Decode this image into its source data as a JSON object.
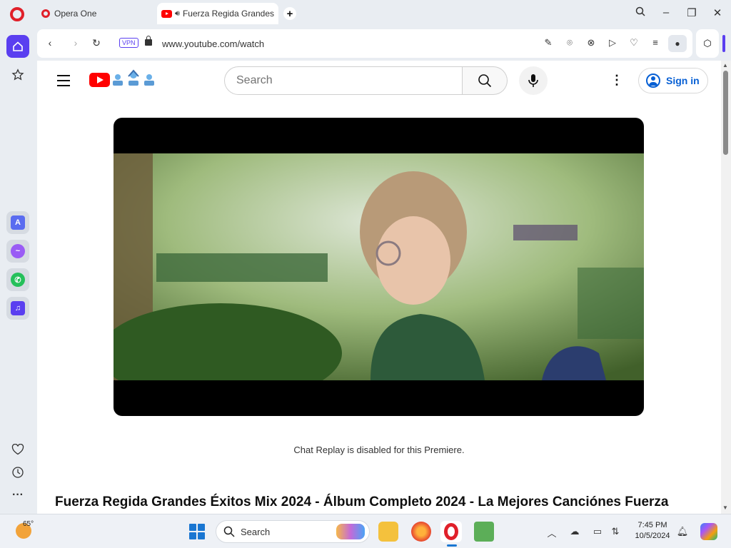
{
  "browser": {
    "tabs": [
      {
        "label": "Opera One"
      },
      {
        "label": "Fuerza Regida Grandes"
      }
    ],
    "new_tab_icon": "plus-icon",
    "address": {
      "vpn_label": "VPN",
      "url": "www.youtube.com/watch"
    }
  },
  "youtube": {
    "search_placeholder": "Search",
    "sign_in_label": "Sign in",
    "chat_note": "Chat Replay is disabled for this Premiere.",
    "video_title": "Fuerza Regida Grandes Éxitos Mix 2024 - Álbum Completo 2024 - La Mejores Canciónes Fuerza",
    "brand_color": "#ff0000",
    "link_color": "#065fd4"
  },
  "taskbar": {
    "temperature": "65°",
    "search_label": "Search",
    "time": "7:45 PM",
    "date": "10/5/2024"
  },
  "colors": {
    "opera_red": "#e0202a",
    "opera_accent": "#5a3ff0"
  }
}
